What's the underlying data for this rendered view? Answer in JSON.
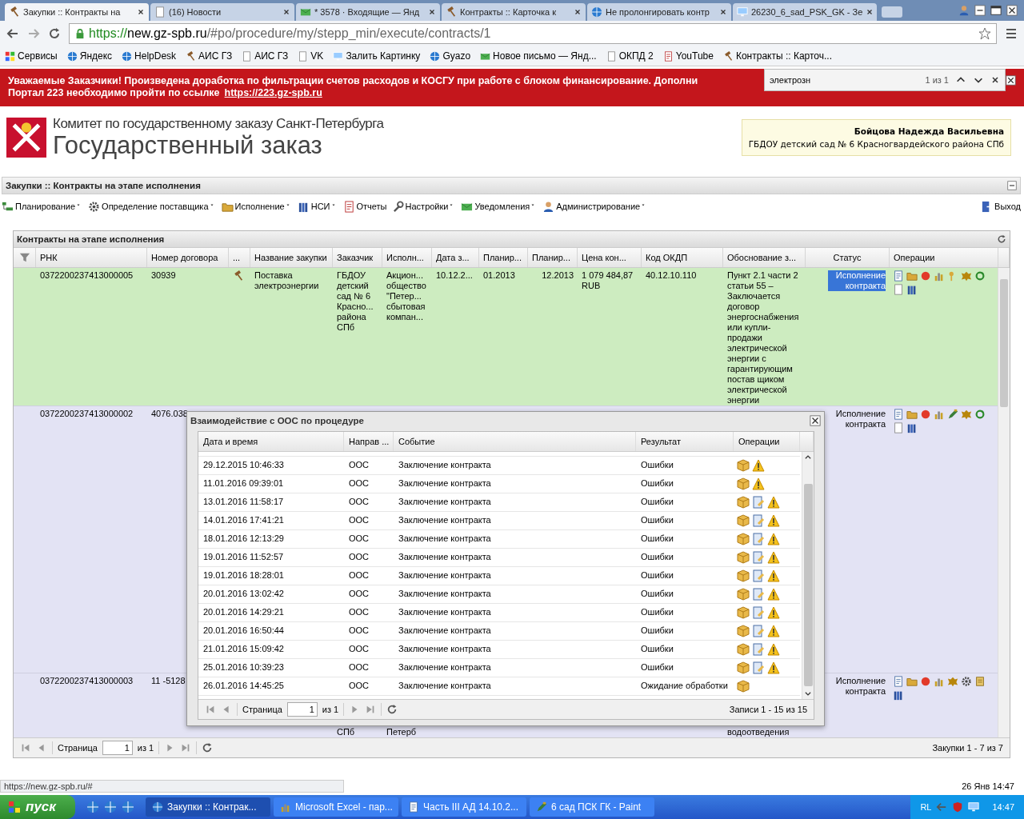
{
  "browser": {
    "tabs": [
      {
        "title": "Закупки :: Контракты на",
        "selected": true
      },
      {
        "title": "(16) Новости",
        "selected": false
      },
      {
        "title": "* 3578 · Входящие — Янд",
        "selected": false
      },
      {
        "title": "Контракты :: Карточка к",
        "selected": false
      },
      {
        "title": "Не пролонгировать контр",
        "selected": false
      },
      {
        "title": "26230_6_sad_PSK_GK - Зе",
        "selected": false
      }
    ],
    "url": {
      "scheme": "https://",
      "host": "new.gz-spb.ru",
      "path": "/#po/procedure/my/stepp_min/execute/contracts/1"
    },
    "bookmarks": [
      "Сервисы",
      "Яндекс",
      "HelpDesk",
      "АИС ГЗ",
      "АИС ГЗ",
      "VK",
      "Залить Картинку",
      "Gyazo",
      "Новое письмо — Янд...",
      "ОКПД 2",
      "YouTube",
      "Контракты :: Карточ..."
    ]
  },
  "find_bar": {
    "value": "электрозн",
    "count": "1 из 1"
  },
  "banner": {
    "line1": "Уважаемые Заказчики! Произведена доработка по фильтрации счетов расходов и КОСГУ при работе с блоком финансирование. Дополни",
    "line2": "Портал 223 необходимо пройти по ссылке",
    "link": "https://223.gz-spb.ru"
  },
  "header": {
    "org": "Комитет по государственному заказу Санкт-Петербурга",
    "title": "Государственный заказ",
    "user": "Бойцова Надежда Васильевна",
    "customer": "ГБДОУ детский сад № 6 Красногвардейского района СПб"
  },
  "panel": {
    "title": "Закупки :: Контракты на этапе исполнения"
  },
  "menu": [
    "Планирование",
    "Определение поставщика",
    "Исполнение",
    "НСИ",
    "Отчеты",
    "Настройки",
    "Уведомления",
    "Администрирование"
  ],
  "logout": "Выход",
  "grid": {
    "title": "Контракты на этапе исполнения",
    "columns": [
      "РНК",
      "Номер договора",
      "...",
      "Название закупки",
      "Заказчик",
      "Исполн...",
      "Дата з...",
      "Планир...",
      "Планир...",
      "Цена кон...",
      "Код ОКДП",
      "Обоснование з...",
      "Статус",
      "Операции"
    ],
    "rows": [
      {
        "selected": true,
        "highlighted": true,
        "cells": [
          "0372200237413000005",
          "30939",
          "",
          "Поставка электроэнергии",
          "ГБДОУ\nдетский\nсад № 6\nКрасно...\nрайона\nСПб",
          "Акцион...\nобщество\n\"Петер...\nсбытовая\nкомпан...",
          "10.12.2...",
          "01.2013",
          "12.2013",
          "1 079 484,87\nRUB",
          "40.12.10.110",
          "Пункт 2.1 части 2 статьи 55 – Заключается договор энергоснабжения или купли-продажи электрической энергии с гарантирующим постав щиком электрической энергии",
          "Исполнение контракта"
        ]
      },
      {
        "selected": false,
        "highlighted": false,
        "cells": [
          "0372200237413000002",
          "4076.038",
          "",
          "",
          "",
          "",
          "",
          "",
          "",
          "",
          "",
          "",
          "Исполнение контракта"
        ]
      },
      {
        "selected": false,
        "highlighted": false,
        "cells": [
          "0372200237413000003",
          "11 -5128",
          "",
          "",
          "СПб",
          "Петерб",
          "",
          "",
          "",
          "",
          "",
          "водоотведения",
          "Исполнение контракта"
        ]
      }
    ],
    "paging": {
      "label": "Страница",
      "page": "1",
      "of": "из 1",
      "summary": "Закупки 1 - 7 из 7"
    }
  },
  "dialog": {
    "title": "Взаимодействие с ООС по процедуре",
    "columns": [
      "Дата и время",
      "Направ ...",
      "Событие",
      "Результат",
      "Операции"
    ],
    "rows": [
      {
        "kind": "error",
        "document": false,
        "cells": [
          "29.12.2015 10:46:33",
          "ООС",
          "Заключение контракта",
          "Ошибки"
        ]
      },
      {
        "kind": "error",
        "document": false,
        "cells": [
          "11.01.2016 09:39:01",
          "ООС",
          "Заключение контракта",
          "Ошибки"
        ]
      },
      {
        "kind": "error",
        "document": true,
        "cells": [
          "13.01.2016 11:58:17",
          "ООС",
          "Заключение контракта",
          "Ошибки"
        ]
      },
      {
        "kind": "error",
        "document": true,
        "cells": [
          "14.01.2016 17:41:21",
          "ООС",
          "Заключение контракта",
          "Ошибки"
        ]
      },
      {
        "kind": "error",
        "document": true,
        "cells": [
          "18.01.2016 12:13:29",
          "ООС",
          "Заключение контракта",
          "Ошибки"
        ]
      },
      {
        "kind": "error",
        "document": true,
        "cells": [
          "19.01.2016 11:52:57",
          "ООС",
          "Заключение контракта",
          "Ошибки"
        ]
      },
      {
        "kind": "error",
        "document": true,
        "cells": [
          "19.01.2016 18:28:01",
          "ООС",
          "Заключение контракта",
          "Ошибки"
        ]
      },
      {
        "kind": "error",
        "document": true,
        "cells": [
          "20.01.2016 13:02:42",
          "ООС",
          "Заключение контракта",
          "Ошибки"
        ]
      },
      {
        "kind": "error",
        "document": true,
        "cells": [
          "20.01.2016 14:29:21",
          "ООС",
          "Заключение контракта",
          "Ошибки"
        ]
      },
      {
        "kind": "error",
        "document": true,
        "cells": [
          "20.01.2016 16:50:44",
          "ООС",
          "Заключение контракта",
          "Ошибки"
        ]
      },
      {
        "kind": "error",
        "document": true,
        "cells": [
          "21.01.2016 15:09:42",
          "ООС",
          "Заключение контракта",
          "Ошибки"
        ]
      },
      {
        "kind": "error",
        "document": true,
        "cells": [
          "25.01.2016 10:39:23",
          "ООС",
          "Заключение контракта",
          "Ошибки"
        ]
      },
      {
        "kind": "pending",
        "document": false,
        "cells": [
          "26.01.2016 14:45:25",
          "ООС",
          "Заключение контракта",
          "Ожидание обработки"
        ]
      }
    ],
    "paging": {
      "label": "Страница",
      "page": "1",
      "of": "из 1",
      "summary": "Записи 1 - 15 из 15"
    }
  },
  "status_url": "https://new.gz-spb.ru/#",
  "datetime": "26 Янв 14:47",
  "taskbar": {
    "start": "пуск",
    "tasks": [
      {
        "title": "Закупки :: Контрак...",
        "selected": true
      },
      {
        "title": "Microsoft Excel - пар...",
        "selected": false
      },
      {
        "title": "Часть III АД 14.10.2...",
        "selected": false
      },
      {
        "title": "6 сад ПСК ГК - Paint",
        "selected": false
      }
    ],
    "lang": "RL",
    "clock": "14:47"
  }
}
